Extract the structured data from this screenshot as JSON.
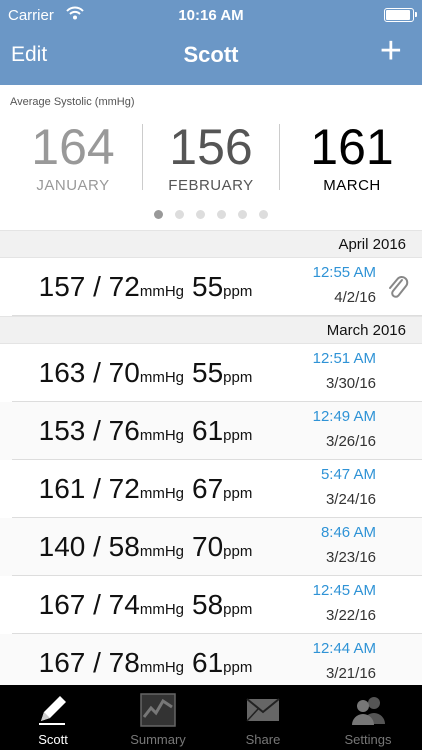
{
  "status_bar": {
    "carrier": "Carrier",
    "time": "10:16 AM"
  },
  "nav": {
    "edit_label": "Edit",
    "title": "Scott",
    "add_label": "+"
  },
  "summary": {
    "label": "Average Systolic (mmHg)",
    "months": [
      {
        "value": "164",
        "name": "JANUARY"
      },
      {
        "value": "156",
        "name": "FEBRUARY"
      },
      {
        "value": "161",
        "name": "MARCH"
      }
    ],
    "page_count": 6,
    "active_page": 0
  },
  "sections": [
    {
      "title": "April 2016",
      "rows": [
        {
          "bp": "157 / 72",
          "bp_unit": "mmHg",
          "pulse": "55",
          "pulse_unit": "ppm",
          "time": "12:55 AM",
          "date": "4/2/16",
          "attachment": true
        }
      ]
    },
    {
      "title": "March 2016",
      "rows": [
        {
          "bp": "163 / 70",
          "bp_unit": "mmHg",
          "pulse": "55",
          "pulse_unit": "ppm",
          "time": "12:51 AM",
          "date": "3/30/16"
        },
        {
          "bp": "153 / 76",
          "bp_unit": "mmHg",
          "pulse": "61",
          "pulse_unit": "ppm",
          "time": "12:49 AM",
          "date": "3/26/16"
        },
        {
          "bp": "161 / 72",
          "bp_unit": "mmHg",
          "pulse": "67",
          "pulse_unit": "ppm",
          "time": "5:47 AM",
          "date": "3/24/16"
        },
        {
          "bp": "140 / 58",
          "bp_unit": "mmHg",
          "pulse": "70",
          "pulse_unit": "ppm",
          "time": "8:46 AM",
          "date": "3/23/16"
        },
        {
          "bp": "167 / 74",
          "bp_unit": "mmHg",
          "pulse": "58",
          "pulse_unit": "ppm",
          "time": "12:45 AM",
          "date": "3/22/16"
        },
        {
          "bp": "167 / 78",
          "bp_unit": "mmHg",
          "pulse": "61",
          "pulse_unit": "ppm",
          "time": "12:44 AM",
          "date": "3/21/16"
        }
      ]
    }
  ],
  "tabs": [
    {
      "label": "Scott",
      "icon": "pencil-icon",
      "active": true
    },
    {
      "label": "Summary",
      "icon": "chart-icon",
      "active": false
    },
    {
      "label": "Share",
      "icon": "envelope-icon",
      "active": false
    },
    {
      "label": "Settings",
      "icon": "people-icon",
      "active": false
    }
  ],
  "colors": {
    "nav_bar": "#6b97c6",
    "time_accent": "#2f93d6",
    "tab_bar": "#000000"
  }
}
